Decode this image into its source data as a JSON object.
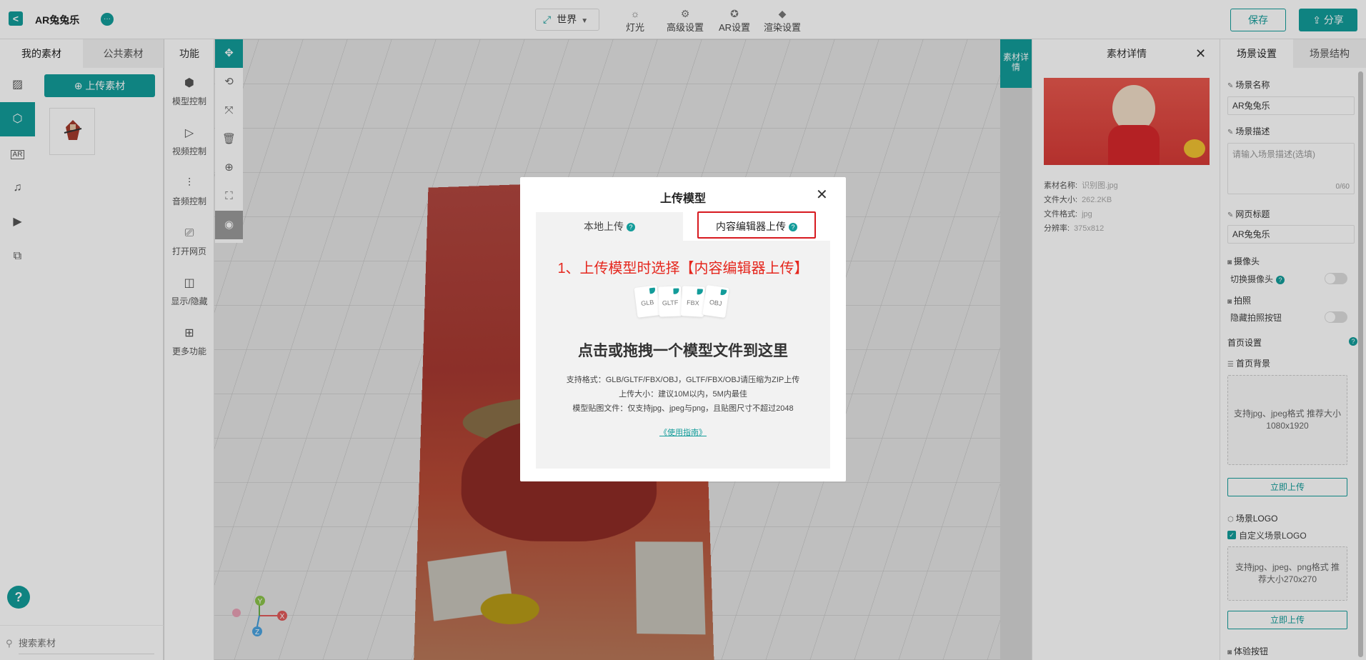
{
  "app": {
    "title": "AR兔兔乐",
    "back_label": "<",
    "chat_label": "···"
  },
  "header": {
    "world_select": "世界",
    "tools": [
      {
        "label": "灯光",
        "icon": "sun-icon"
      },
      {
        "label": "高级设置",
        "icon": "gear-icon"
      },
      {
        "label": "AR设置",
        "icon": "ar-settings-icon"
      },
      {
        "label": "渲染设置",
        "icon": "paint-bucket-icon"
      }
    ],
    "save_label": "保存",
    "share_label": "分享"
  },
  "left": {
    "tab_mine": "我的素材",
    "tab_public": "公共素材",
    "upload_label": "上传素材",
    "search_placeholder": "搜索素材",
    "help_label": "?"
  },
  "functions": {
    "title": "功能",
    "items": [
      {
        "label": "模型控制"
      },
      {
        "label": "视频控制"
      },
      {
        "label": "音频控制"
      },
      {
        "label": "打开网页"
      },
      {
        "label": "显示/隐藏"
      },
      {
        "label": "更多功能"
      }
    ]
  },
  "axes": {
    "x": "X",
    "y": "Y",
    "z": "Z"
  },
  "detail": {
    "vtab": "素材详情",
    "title": "素材详情",
    "rows": [
      {
        "k": "素材名称:",
        "v": "识别图.jpg"
      },
      {
        "k": "文件大小:",
        "v": "262.2KB"
      },
      {
        "k": "文件格式:",
        "v": "jpg"
      },
      {
        "k": "分辨率:",
        "v": "375x812"
      }
    ]
  },
  "scene": {
    "tab_settings": "场景设置",
    "tab_structure": "场景结构",
    "name_label": "场景名称",
    "name_value": "AR兔兔乐",
    "desc_label": "场景描述",
    "desc_placeholder": "请输入场景描述(选填)",
    "desc_count": "0/60",
    "webtitle_label": "网页标题",
    "webtitle_value": "AR兔兔乐",
    "camera_label": "摄像头",
    "camera_switch": "切换摄像头",
    "photo_label": "拍照",
    "photo_hide": "隐藏拍照按钮",
    "home_label": "首页设置",
    "home_bg_label": "首页背景",
    "home_bg_hint": "支持jpg、jpeg格式 推荐大小1080x1920",
    "upload_now": "立即上传",
    "logo_label": "场景LOGO",
    "logo_custom": "自定义场景LOGO",
    "logo_hint": "支持jpg、jpeg、png格式 推荐大小270x270",
    "upload_now_2": "立即上传",
    "experience_label": "体验按钮"
  },
  "modal": {
    "title": "上传模型",
    "tab_local": "本地上传",
    "tab_editor": "内容编辑器上传",
    "instruction": "1、上传模型时选择【内容编辑器上传】",
    "file_types": [
      "GLB",
      "GLTF",
      "FBX",
      "OBJ"
    ],
    "drop_text": "点击或拖拽一个模型文件到这里",
    "info_formats": "支持格式：GLB/GLTF/FBX/OBJ，GLTF/FBX/OBJ请压缩为ZIP上传",
    "info_size": "上传大小：建议10M以内，5M内最佳",
    "info_texture": "模型贴图文件：仅支持jpg、jpeg与png，且贴图尺寸不超过2048",
    "guide_link": "《使用指南》"
  },
  "colors": {
    "accent": "#139c9a",
    "highlight": "#d7191f",
    "instruction_red": "#e5271e"
  }
}
